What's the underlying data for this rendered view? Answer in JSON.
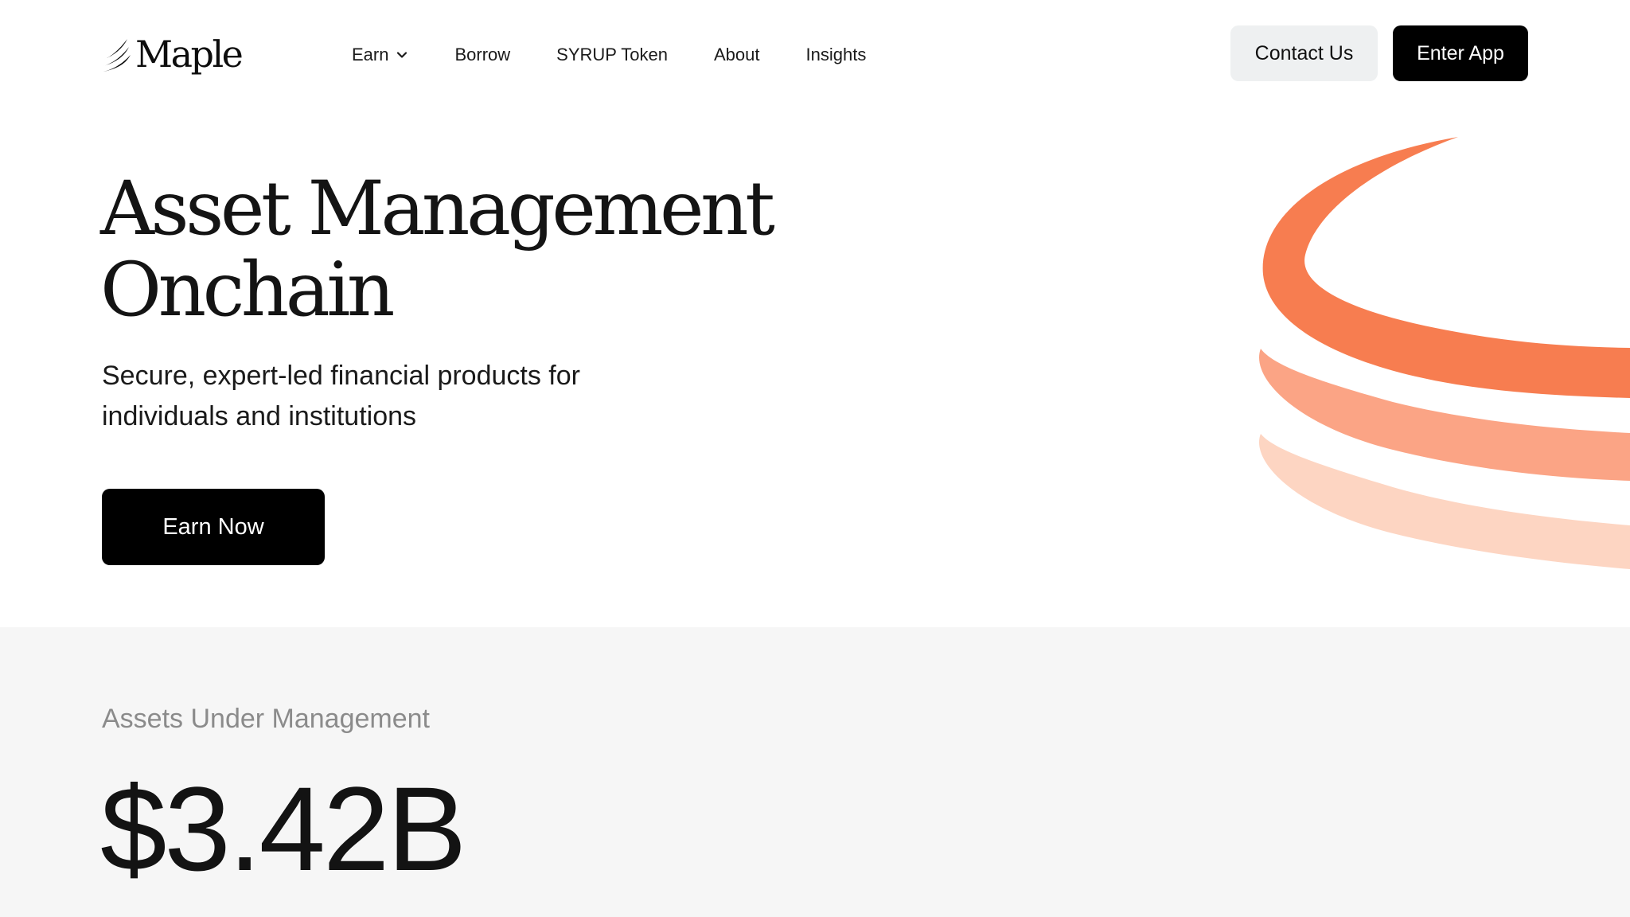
{
  "brand": {
    "name": "Maple"
  },
  "nav": {
    "items": [
      {
        "label": "Earn",
        "has_dropdown": true
      },
      {
        "label": "Borrow"
      },
      {
        "label": "SYRUP Token"
      },
      {
        "label": "About"
      },
      {
        "label": "Insights"
      }
    ]
  },
  "header": {
    "contact_label": "Contact Us",
    "enter_label": "Enter App"
  },
  "hero": {
    "title_line1": "Asset Management",
    "title_line2": "Onchain",
    "subtitle_line1": "Secure, expert-led financial products for",
    "subtitle_line2": "individuals and institutions",
    "cta_label": "Earn Now"
  },
  "stats": {
    "label": "Assets Under Management",
    "value": "$3.42B"
  },
  "colors": {
    "accent": "#f77d50",
    "accent_mid": "#fba485",
    "accent_light": "#fdd5c2",
    "button_dark": "#000000",
    "button_light": "#eef0f1",
    "stats_background": "#f6f6f6"
  },
  "icons": {
    "logo": "maple-logo-icon",
    "dropdown": "chevron-down-icon",
    "decoration": "orange-rings-graphic"
  }
}
